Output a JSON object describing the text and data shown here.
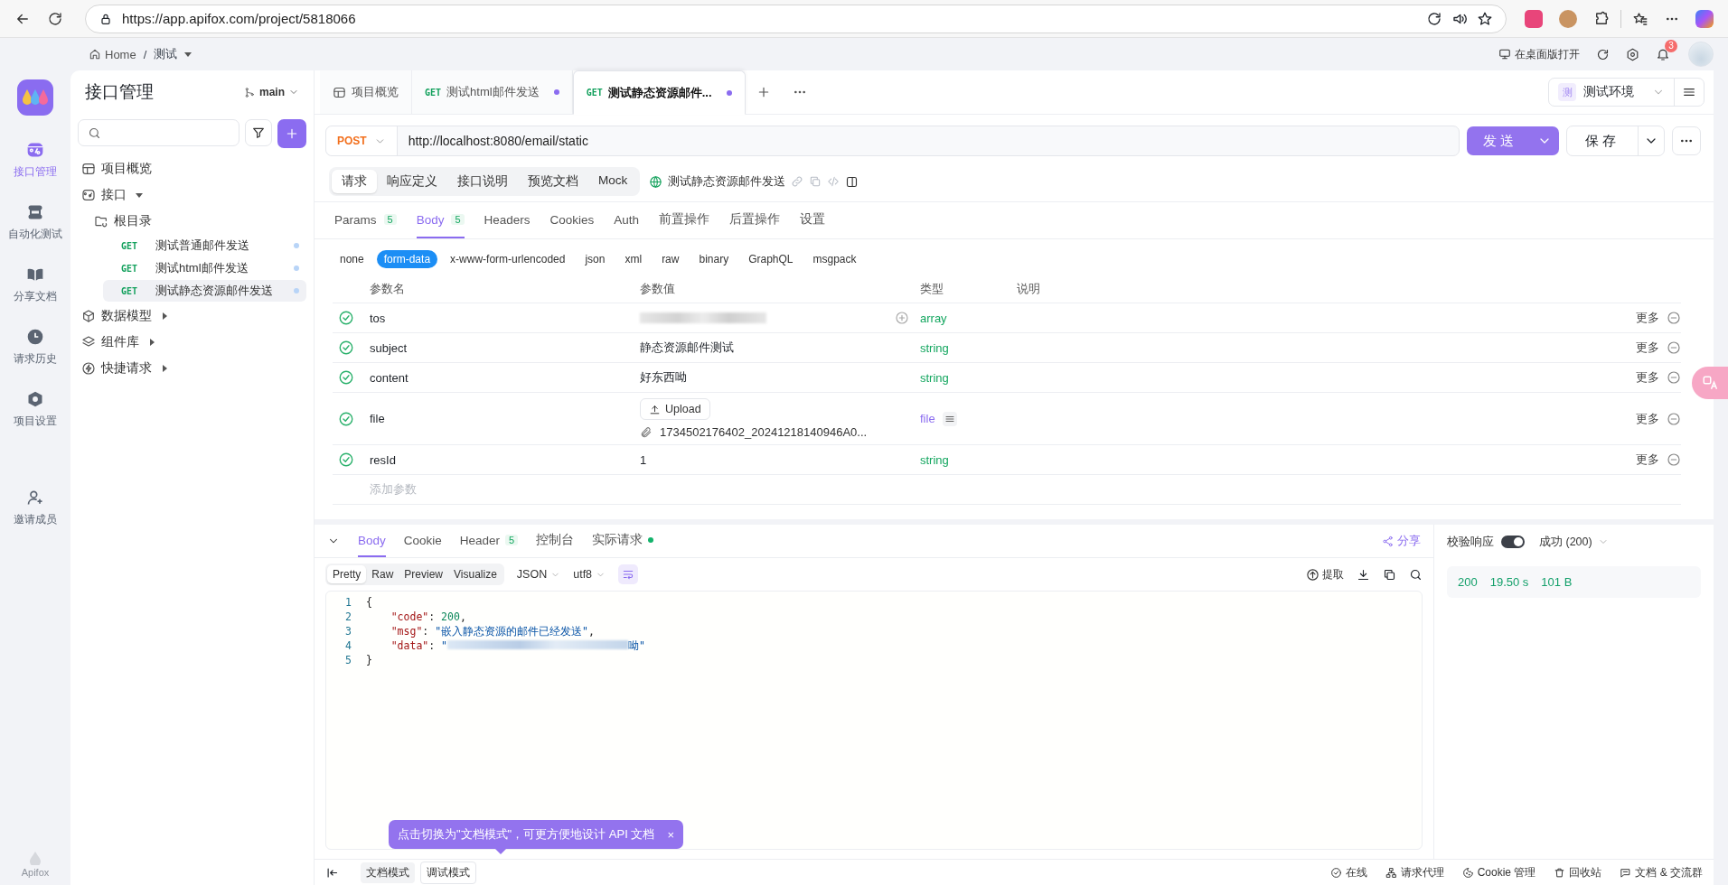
{
  "browser": {
    "url": "https://app.apifox.com/project/5818066"
  },
  "breadcrumb": {
    "home": "Home",
    "separator": "/",
    "project": "测试"
  },
  "header_actions": {
    "open_desktop": "在桌面版打开",
    "notifications": "3"
  },
  "rail": [
    {
      "label": "接口管理",
      "kind": "api",
      "selected": true
    },
    {
      "label": "自动化测试",
      "kind": "automation",
      "selected": false
    },
    {
      "label": "分享文档",
      "kind": "docs",
      "selected": false
    },
    {
      "label": "请求历史",
      "kind": "history",
      "selected": false
    },
    {
      "label": "项目设置",
      "kind": "settings",
      "selected": false
    },
    {
      "label": "邀请成员",
      "kind": "invite",
      "selected": false
    }
  ],
  "rail_footer": "Apifox",
  "sidebar": {
    "title": "接口管理",
    "branch": "main",
    "tree": [
      {
        "label": "项目概览",
        "kind": "overview"
      },
      {
        "label": "接口",
        "kind": "api",
        "expanded": true,
        "children": [
          {
            "label": "根目录",
            "kind": "folder",
            "children": [
              {
                "method": "GET",
                "label": "测试普通邮件发送",
                "selected": false
              },
              {
                "method": "GET",
                "label": "测试html邮件发送",
                "selected": false
              },
              {
                "method": "GET",
                "label": "测试静态资源邮件发送",
                "selected": true
              }
            ]
          }
        ]
      },
      {
        "label": "数据模型",
        "kind": "model",
        "expanded": false
      },
      {
        "label": "组件库",
        "kind": "components",
        "expanded": false
      },
      {
        "label": "快捷请求",
        "kind": "quick",
        "expanded": false
      }
    ]
  },
  "tabs": [
    {
      "label": "项目概览",
      "kind": "overview",
      "selected": false
    },
    {
      "method": "GET",
      "label": "测试html邮件发送",
      "modified": true,
      "selected": false
    },
    {
      "method": "GET",
      "label": "测试静态资源邮件...",
      "modified": true,
      "selected": true
    }
  ],
  "environment": {
    "badge": "测",
    "name": "测试环境"
  },
  "request": {
    "method": "POST",
    "url": "http://localhost:8080/email/static",
    "send": "发送",
    "save": "保存"
  },
  "mode_tabs": [
    {
      "label": "请求",
      "selected": true
    },
    {
      "label": "响应定义",
      "selected": false
    },
    {
      "label": "接口说明",
      "selected": false
    },
    {
      "label": "预览文档",
      "selected": false
    },
    {
      "label": "Mock",
      "selected": false
    }
  ],
  "api_name": "测试静态资源邮件发送",
  "param_tabs": [
    {
      "label": "Params",
      "count": "5",
      "selected": false
    },
    {
      "label": "Body",
      "count": "5",
      "selected": true
    },
    {
      "label": "Headers",
      "selected": false
    },
    {
      "label": "Cookies",
      "selected": false
    },
    {
      "label": "Auth",
      "selected": false
    },
    {
      "label": "前置操作",
      "selected": false
    },
    {
      "label": "后置操作",
      "selected": false
    },
    {
      "label": "设置",
      "selected": false
    }
  ],
  "body_types": [
    {
      "label": "none",
      "selected": false
    },
    {
      "label": "form-data",
      "selected": true
    },
    {
      "label": "x-www-form-urlencoded",
      "selected": false
    },
    {
      "label": "json",
      "selected": false
    },
    {
      "label": "xml",
      "selected": false
    },
    {
      "label": "raw",
      "selected": false
    },
    {
      "label": "binary",
      "selected": false
    },
    {
      "label": "GraphQL",
      "selected": false
    },
    {
      "label": "msgpack",
      "selected": false
    }
  ],
  "params": {
    "columns": [
      "参数名",
      "参数值",
      "类型",
      "说明"
    ],
    "rows": [
      {
        "kind": "redacted",
        "enabled": true,
        "name": "tos",
        "type": "array",
        "more": "更多"
      },
      {
        "kind": "text",
        "enabled": true,
        "name": "subject",
        "value": "静态资源邮件测试",
        "type": "string",
        "more": "更多"
      },
      {
        "kind": "text",
        "enabled": true,
        "name": "content",
        "value": "好东西呦",
        "type": "string",
        "more": "更多"
      },
      {
        "kind": "file",
        "enabled": true,
        "name": "file",
        "upload": "Upload",
        "file_name": "1734502176402_20241218140946A0...",
        "type": "file",
        "more": "更多"
      },
      {
        "kind": "text",
        "enabled": true,
        "name": "resId",
        "value": "1",
        "type": "string",
        "more": "更多"
      }
    ],
    "add_placeholder": "添加参数"
  },
  "response": {
    "tabs": [
      {
        "label": "Body",
        "selected": true
      },
      {
        "label": "Cookie",
        "selected": false
      },
      {
        "label": "Header",
        "count": "5",
        "selected": false
      },
      {
        "label": "控制台",
        "selected": false
      },
      {
        "label": "实际请求",
        "dot": true,
        "selected": false
      }
    ],
    "share": "分享",
    "views": [
      {
        "label": "Pretty",
        "selected": true
      },
      {
        "label": "Raw",
        "selected": false
      },
      {
        "label": "Preview",
        "selected": false
      },
      {
        "label": "Visualize",
        "selected": false
      }
    ],
    "format": "JSON",
    "encoding": "utf8",
    "extract": "提取",
    "lines": [
      {
        "number": "1",
        "tokens": [
          {
            "kind": "punct",
            "text": "{"
          }
        ]
      },
      {
        "number": "2",
        "tokens": [
          {
            "kind": "key",
            "text": "    \"code\""
          },
          {
            "kind": "punct",
            "text": ": "
          },
          {
            "kind": "number",
            "text": "200"
          },
          {
            "kind": "punct",
            "text": ","
          }
        ]
      },
      {
        "number": "3",
        "tokens": [
          {
            "kind": "key",
            "text": "    \"msg\""
          },
          {
            "kind": "punct",
            "text": ": "
          },
          {
            "kind": "string",
            "text": "\"嵌入静态资源的邮件已经发送\""
          },
          {
            "kind": "punct",
            "text": ","
          }
        ]
      },
      {
        "number": "4",
        "tokens": [
          {
            "kind": "key",
            "text": "    \"data\""
          },
          {
            "kind": "punct",
            "text": ": "
          },
          {
            "kind": "string",
            "text": "\""
          },
          {
            "kind": "redacted"
          },
          {
            "kind": "string",
            "text": "呦\""
          }
        ]
      },
      {
        "number": "5",
        "tokens": [
          {
            "kind": "punct",
            "text": "}"
          }
        ]
      }
    ]
  },
  "check_panel": {
    "label": "校验响应",
    "on": true,
    "status": "成功 (200)",
    "code": "200",
    "time": "19.50 s",
    "size": "101 B"
  },
  "tooltip": {
    "text": "点击切换为\"文档模式\"，可更方便地设计 API 文档",
    "close": "×"
  },
  "bottom": {
    "modes": [
      {
        "label": "文档模式",
        "selected": false
      },
      {
        "label": "调试模式",
        "selected": true
      }
    ],
    "status": [
      {
        "kind": "online",
        "label": "在线"
      },
      {
        "kind": "proxy",
        "label": "请求代理"
      },
      {
        "kind": "cookie",
        "label": "Cookie 管理"
      },
      {
        "kind": "trash",
        "label": "回收站"
      },
      {
        "kind": "community",
        "label": "文档 & 交流群"
      }
    ]
  }
}
